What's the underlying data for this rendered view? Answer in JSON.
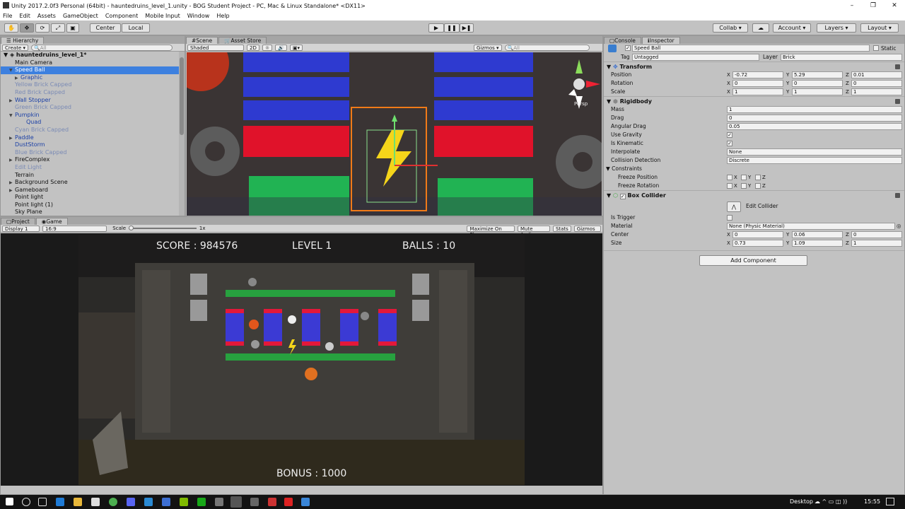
{
  "window": {
    "title": "Unity 2017.2.0f3 Personal (64bit) - hauntedruins_level_1.unity - BOG Student Project - PC, Mac & Linux Standalone* <DX11>"
  },
  "menu": [
    "File",
    "Edit",
    "Assets",
    "GameObject",
    "Component",
    "Mobile Input",
    "Window",
    "Help"
  ],
  "toolbar": {
    "pivot": "Center",
    "space": "Local",
    "collab": "Collab",
    "account": "Account",
    "layers": "Layers",
    "layout": "Layout"
  },
  "hierarchy": {
    "tab": "Hierarchy",
    "create": "Create",
    "search_placeholder": "All",
    "scene_name": "hauntedruins_level_1*",
    "items": [
      {
        "label": "Main Camera",
        "style": "",
        "indent": 1,
        "arrow": ""
      },
      {
        "label": "Speed Ball",
        "style": "sel",
        "indent": 1,
        "arrow": "▼"
      },
      {
        "label": "Graphic",
        "style": "prefab",
        "indent": 2,
        "arrow": "▶"
      },
      {
        "label": "Yellow Brick Capped",
        "style": "dis",
        "indent": 1,
        "arrow": ""
      },
      {
        "label": "Red Brick Capped",
        "style": "dis",
        "indent": 1,
        "arrow": ""
      },
      {
        "label": "Wall Stopper",
        "style": "prefab",
        "indent": 1,
        "arrow": "▶"
      },
      {
        "label": "Green Brick Capped",
        "style": "dis",
        "indent": 1,
        "arrow": ""
      },
      {
        "label": "Pumpkin",
        "style": "prefab",
        "indent": 1,
        "arrow": "▼"
      },
      {
        "label": "Quad",
        "style": "prefab",
        "indent": 3,
        "arrow": ""
      },
      {
        "label": "Cyan Brick Capped",
        "style": "dis",
        "indent": 1,
        "arrow": ""
      },
      {
        "label": "Paddle",
        "style": "prefab",
        "indent": 1,
        "arrow": "▶"
      },
      {
        "label": "DustStorm",
        "style": "prefab",
        "indent": 1,
        "arrow": ""
      },
      {
        "label": "Blue Brick Capped",
        "style": "dis",
        "indent": 1,
        "arrow": ""
      },
      {
        "label": "FireComplex",
        "style": "",
        "indent": 1,
        "arrow": "▶"
      },
      {
        "label": "Edit Light",
        "style": "dis",
        "indent": 1,
        "arrow": ""
      },
      {
        "label": "Terrain",
        "style": "",
        "indent": 1,
        "arrow": ""
      },
      {
        "label": "Background Scene",
        "style": "",
        "indent": 1,
        "arrow": "▶"
      },
      {
        "label": "Gameboard",
        "style": "",
        "indent": 1,
        "arrow": "▶"
      },
      {
        "label": "Point light",
        "style": "",
        "indent": 1,
        "arrow": ""
      },
      {
        "label": "Point light (1)",
        "style": "",
        "indent": 1,
        "arrow": ""
      },
      {
        "label": "Sky Plane",
        "style": "",
        "indent": 1,
        "arrow": ""
      }
    ]
  },
  "scene": {
    "tabs": [
      "Scene",
      "Asset Store"
    ],
    "shading": "Shaded",
    "mode2d": "2D",
    "gizmos": "Gizmos",
    "search_placeholder": "All",
    "persp": "Persp"
  },
  "project_tab": "Project",
  "game": {
    "tab": "Game",
    "display": "Display 1",
    "aspect": "16:9",
    "scale_label": "Scale",
    "scale_value": "1x",
    "toggles": [
      "Maximize On Play",
      "Mute Audio",
      "Stats",
      "Gizmos"
    ],
    "hud": {
      "score": "SCORE : 984576",
      "level": "LEVEL 1",
      "balls": "BALLS : 10",
      "bonus": "BONUS : 1000"
    }
  },
  "inspector": {
    "tabs": [
      "Console",
      "Inspector"
    ],
    "object_name": "Speed Ball",
    "static_label": "Static",
    "tag_label": "Tag",
    "tag": "Untagged",
    "layer_label": "Layer",
    "layer": "Brick",
    "transform": {
      "title": "Transform",
      "rows": [
        {
          "label": "Position",
          "x": "-0.72",
          "y": "5.29",
          "z": "0.01"
        },
        {
          "label": "Rotation",
          "x": "0",
          "y": "0",
          "z": "0"
        },
        {
          "label": "Scale",
          "x": "1",
          "y": "1",
          "z": "1"
        }
      ]
    },
    "rigidbody": {
      "title": "Rigidbody",
      "mass_label": "Mass",
      "mass": "1",
      "drag_label": "Drag",
      "drag": "0",
      "angular_label": "Angular Drag",
      "angular": "0.05",
      "gravity_label": "Use Gravity",
      "kinematic_label": "Is Kinematic",
      "interpolate_label": "Interpolate",
      "interpolate": "None",
      "collision_label": "Collision Detection",
      "collision": "Discrete",
      "constraints_label": "Constraints",
      "freeze_pos_label": "Freeze Position",
      "freeze_rot_label": "Freeze Rotation",
      "axes": [
        "X",
        "Y",
        "Z"
      ]
    },
    "box_collider": {
      "title": "Box Collider",
      "edit_label": "Edit Collider",
      "trigger_label": "Is Trigger",
      "material_label": "Material",
      "material": "None (Physic Material)",
      "center_label": "Center",
      "center": {
        "x": "0",
        "y": "0.06",
        "z": "0"
      },
      "size_label": "Size",
      "size": {
        "x": "0.73",
        "y": "1.09",
        "z": "1"
      }
    },
    "add_component": "Add Component"
  },
  "taskbar": {
    "desktop": "Desktop",
    "time": "15:55"
  }
}
